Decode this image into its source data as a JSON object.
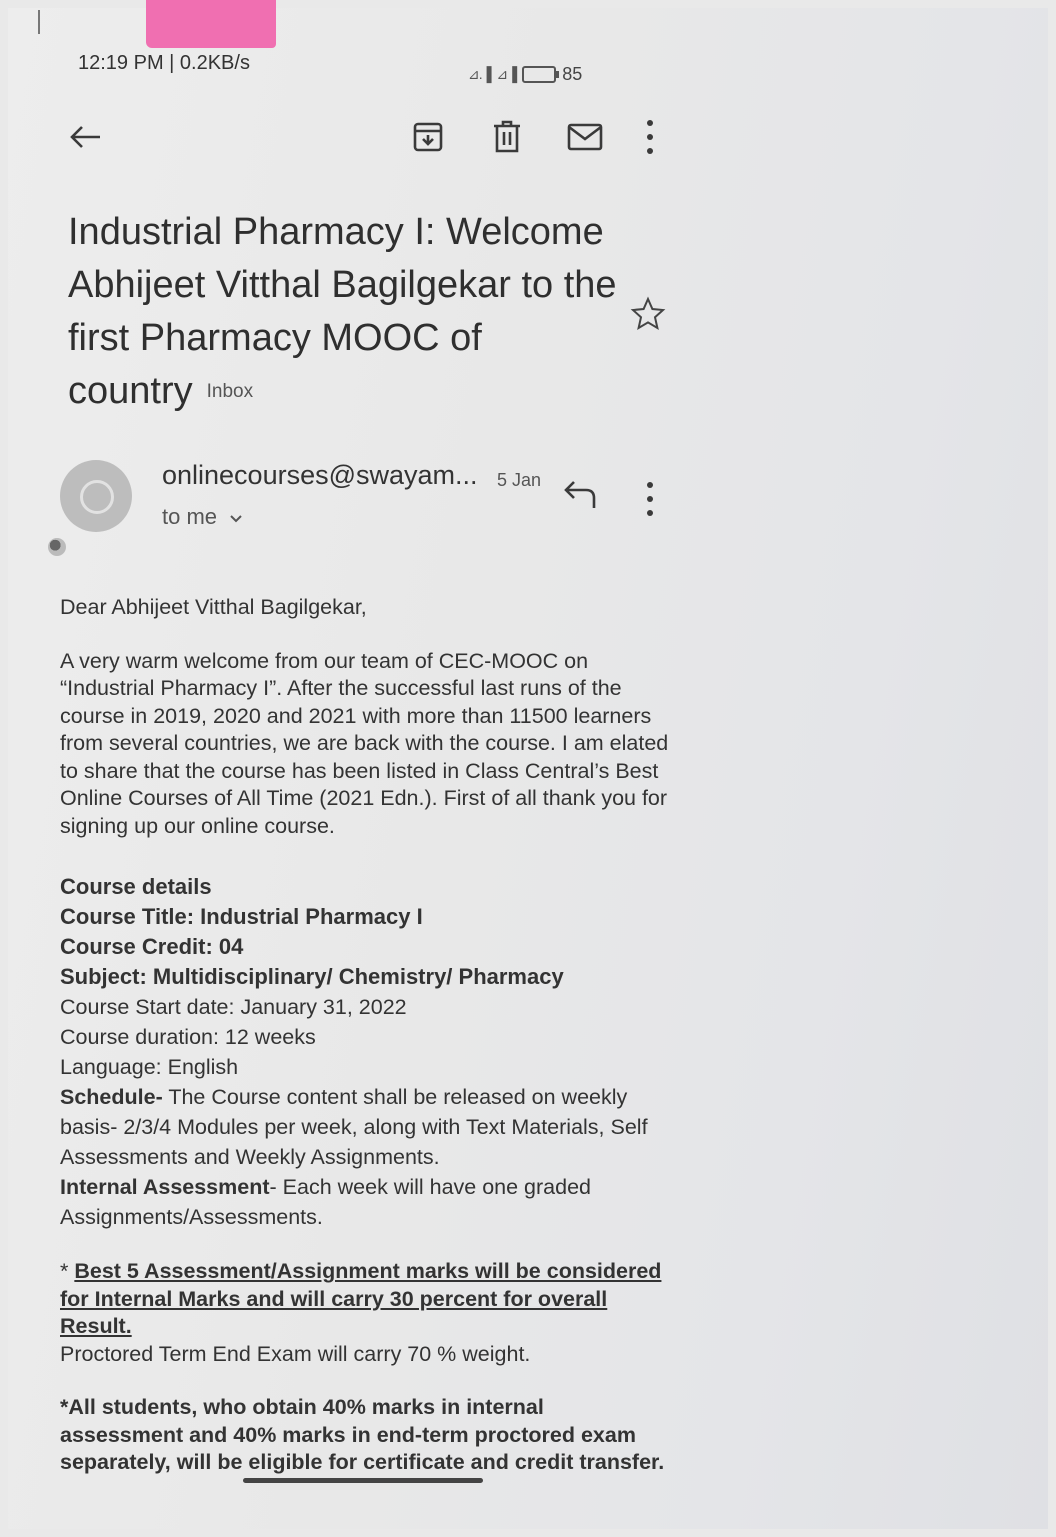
{
  "status_bar": {
    "time": "12:19 PM | 0.2KB/s",
    "signal_1": "⊿.▐",
    "signal_2": "⊿▐",
    "battery": "85"
  },
  "toolbar": {
    "back_icon": "arrow-left-icon",
    "archive_icon": "archive-icon",
    "delete_icon": "trash-icon",
    "mark_unread_icon": "envelope-icon",
    "more_icon": "more-vertical-icon"
  },
  "email": {
    "subject": "Industrial Pharmacy I: Welcome Abhijeet Vitthal Bagilgekar to the first Pharmacy MOOC of country",
    "label": "Inbox",
    "sender": "onlinecourses@swayam...",
    "date": "5 Jan",
    "recipient": "to me",
    "greeting": "Dear Abhijeet Vitthal Bagilgekar,",
    "intro": "A very warm welcome from our team of CEC-MOOC on “Industrial Pharmacy I”. After the successful last runs of the course in 2019, 2020 and 2021 with more than 11500 learners from several countries, we are back with the course. I am elated to share that the course has been listed in Class Central’s Best Online Courses of All Time (2021 Edn.). First of all thank you for signing up our online course.",
    "course_details": {
      "heading": "Course details",
      "title": "Course Title: Industrial Pharmacy I",
      "credit": "Course Credit:  04",
      "subject": "Subject: Multidisciplinary/ Chemistry/ Pharmacy",
      "start_date": "Course Start date: January 31, 2022",
      "duration": "Course duration: 12 weeks",
      "language": "Language: English",
      "schedule_label": "Schedule-",
      "schedule_text": " The Course content shall be released on weekly basis- 2/3/4 Modules per week, along with Text Materials, Self Assessments and Weekly Assignments.",
      "assessment_label": "Internal Assessment",
      "assessment_text": "- Each week will have one graded Assignments/Assessments."
    },
    "best_five_prefix": "* ",
    "best_five": "Best 5 Assessment/Assignment marks will be considered for Internal Marks and will carry 30 percent for overall Result.",
    "proctored": "Proctored Term End Exam will carry 70 % weight.",
    "eligibility": "*All students, who obtain 40% marks in internal assessment and 40% marks in end-term proctored exam separately, will be eligible for certificate and credit transfer."
  }
}
